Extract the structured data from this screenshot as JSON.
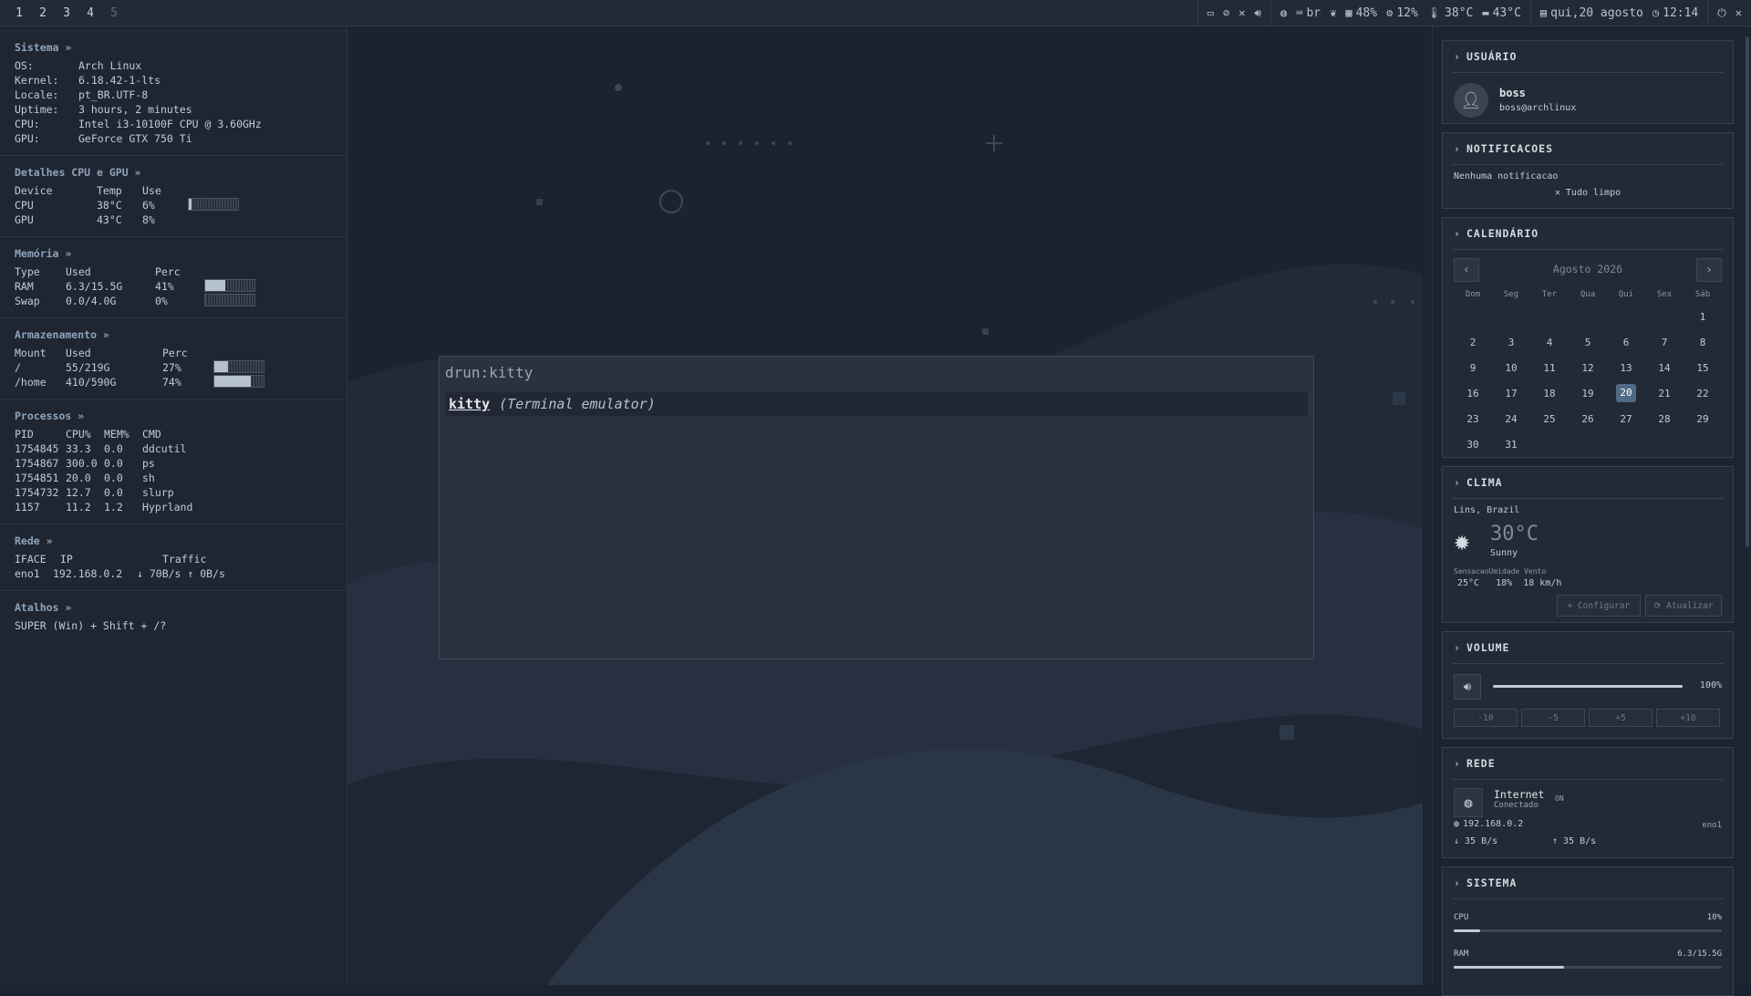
{
  "topbar": {
    "workspaces": [
      "1",
      "2",
      "3",
      "4",
      "5"
    ],
    "kbd_layout": "br",
    "mem_percent": "48%",
    "cpu_percent": "12%",
    "cpu_temp": "38°C",
    "gpu_temp": "43°C",
    "date": "qui,20 agosto",
    "time": "12:14"
  },
  "system": {
    "title": "Sistema »",
    "rows": [
      {
        "k": "OS:",
        "v": "Arch Linux"
      },
      {
        "k": "Kernel:",
        "v": "6.18.42-1-lts"
      },
      {
        "k": "Locale:",
        "v": "pt_BR.UTF-8"
      },
      {
        "k": "Uptime:",
        "v": "3 hours, 2 minutes"
      },
      {
        "k": "CPU:",
        "v": "Intel i3-10100F CPU @ 3.60GHz"
      },
      {
        "k": "GPU:",
        "v": "GeForce GTX 750 Ti"
      }
    ]
  },
  "cpugpu": {
    "title": "Detalhes CPU e GPU »",
    "headers": [
      "Device",
      "Temp",
      "Use"
    ],
    "rows": [
      {
        "device": "CPU",
        "temp": "38°C",
        "use": "6%",
        "level": 0.06
      },
      {
        "device": "GPU",
        "temp": "43°C",
        "use": "8%",
        "level": 0.08
      }
    ]
  },
  "memory": {
    "title": "Memória »",
    "headers": [
      "Type",
      "Used",
      "Perc"
    ],
    "rows": [
      {
        "type": "RAM",
        "used": "6.3/15.5G",
        "perc": "41%",
        "level": 0.41
      },
      {
        "type": "Swap",
        "used": "0.0/4.0G",
        "perc": "0%",
        "level": 0
      }
    ]
  },
  "storage": {
    "title": "Armazenamento »",
    "headers": [
      "Mount",
      "Used",
      "Perc"
    ],
    "rows": [
      {
        "mount": "/",
        "used": "55/219G",
        "perc": "27%",
        "level": 0.27
      },
      {
        "mount": "/home",
        "used": "410/590G",
        "perc": "74%",
        "level": 0.74
      }
    ]
  },
  "processes": {
    "title": "Processos »",
    "headers": [
      "PID",
      "CPU%",
      "MEM%",
      "CMD"
    ],
    "rows": [
      {
        "pid": "1754845",
        "cpu": "33.3",
        "mem": "0.0",
        "cmd": "ddcutil"
      },
      {
        "pid": "1754867",
        "cpu": "300.0",
        "mem": "0.0",
        "cmd": "ps"
      },
      {
        "pid": "1754851",
        "cpu": "20.0",
        "mem": "0.0",
        "cmd": "sh"
      },
      {
        "pid": "1754732",
        "cpu": "12.7",
        "mem": "0.0",
        "cmd": "slurp"
      },
      {
        "pid": "1157",
        "cpu": "11.2",
        "mem": "1.2",
        "cmd": "Hyprland"
      }
    ]
  },
  "network_left": {
    "title": "Rede »",
    "headers": [
      "IFACE",
      "IP",
      "Traffic"
    ],
    "iface": "eno1",
    "ip": "192.168.0.2",
    "traffic": "↓ 70B/s ↑ 0B/s"
  },
  "shortcuts": {
    "title": "Atalhos »",
    "text": "SUPER (Win) + Shift + /?"
  },
  "launcher": {
    "prompt": "drun:kitty",
    "entry_name": "kitty",
    "entry_desc": "(Terminal emulator)"
  },
  "user_card": {
    "title": "USUÁRIO",
    "name": "boss",
    "host": "boss@archlinux"
  },
  "notif_card": {
    "title": "NOTIFICACOES",
    "empty": "Nenhuma notificacao",
    "clear": "✕  Tudo limpo"
  },
  "calendar": {
    "title": "CALENDÁRIO",
    "month": "Agosto  2026",
    "weekdays": [
      "Dom",
      "Seg",
      "Ter",
      "Qua",
      "Qui",
      "Sex",
      "Sáb"
    ],
    "weeks": [
      [
        "",
        "",
        "",
        "",
        "",
        "",
        "1"
      ],
      [
        "2",
        "3",
        "4",
        "5",
        "6",
        "7",
        "8"
      ],
      [
        "9",
        "10",
        "11",
        "12",
        "13",
        "14",
        "15"
      ],
      [
        "16",
        "17",
        "18",
        "19",
        "20",
        "21",
        "22"
      ],
      [
        "23",
        "24",
        "25",
        "26",
        "27",
        "28",
        "29"
      ],
      [
        "30",
        "31",
        "",
        "",
        "",
        "",
        ""
      ]
    ],
    "today": "20"
  },
  "weather": {
    "title": "CLIMA",
    "location": "Lins, Brazil",
    "temp": "30°C",
    "cond": "Sunny",
    "labels": "SensacaoUmidade  Vento",
    "values": "25°C   18%  18 km/h",
    "btn_config": "Configurar",
    "btn_update": "Atualizar"
  },
  "volume": {
    "title": "VOLUME",
    "percent": "100%",
    "level": 1.0,
    "steps": [
      "-10",
      "-5",
      "+5",
      "+10"
    ]
  },
  "net_card": {
    "title": "REDE",
    "name": "Internet",
    "status": "Conectado",
    "onoff": "ON",
    "ip": "192.168.0.2",
    "iface": "eno1",
    "down": "↓ 35 B/s",
    "up": "↑ 35 B/s"
  },
  "sys_card": {
    "title": "SISTEMA",
    "cpu_label": "CPU",
    "cpu_val": "10%",
    "cpu_level": 0.1,
    "ram_label": "RAM",
    "ram_val": "6.3/15.5G",
    "ram_level": 0.41
  },
  "colors": {
    "accent": "#4f6b85",
    "bg": "#1b2230",
    "panel": "#1f2631"
  }
}
